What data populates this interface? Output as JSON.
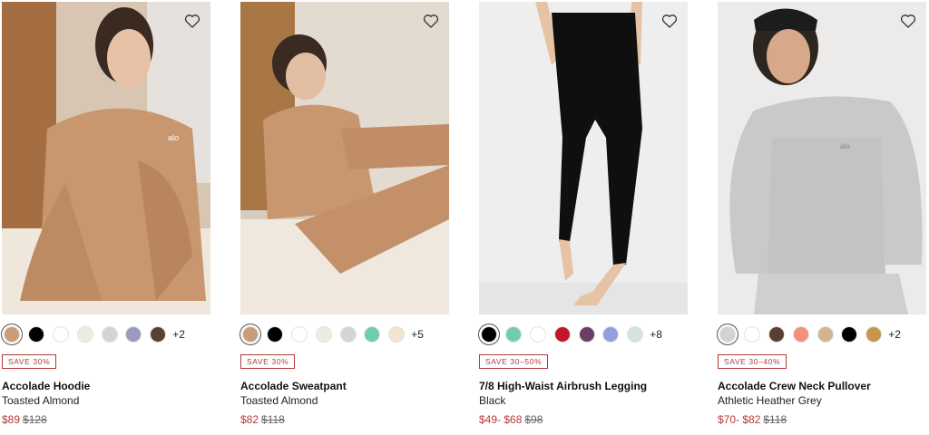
{
  "products": [
    {
      "name": "Accolade Hoodie",
      "color": "Toasted Almond",
      "badge": "SAVE 30%",
      "price": "$89",
      "original_price": "$128",
      "more_colors": "+2",
      "swatches": [
        "#c89d78",
        "#000000",
        "#ffffff",
        "#eeebe3",
        "#d4d4d6",
        "#9a9bbd",
        "#5a4030"
      ],
      "selected_swatch": 0
    },
    {
      "name": "Accolade Sweatpant",
      "color": "Toasted Almond",
      "badge": "SAVE 30%",
      "price": "$82",
      "original_price": "$118",
      "more_colors": "+5",
      "swatches": [
        "#c89d78",
        "#000000",
        "#ffffff",
        "#eeebe3",
        "#d4d4d6",
        "#6fcdae",
        "#f4e4d0"
      ],
      "selected_swatch": 0
    },
    {
      "name": "7/8 High-Waist Airbrush Legging",
      "color": "Black",
      "badge": "SAVE 30–50%",
      "price": "$49- $68",
      "original_price": "$98",
      "more_colors": "+8",
      "swatches": [
        "#000000",
        "#6fcdae",
        "#ffffff",
        "#c0182a",
        "#6a3e62",
        "#929fe0",
        "#d6e2dc"
      ],
      "selected_swatch": 0
    },
    {
      "name": "Accolade Crew Neck Pullover",
      "color": "Athletic Heather Grey",
      "badge": "SAVE 30–40%",
      "price": "$70- $82",
      "original_price": "$118",
      "more_colors": "+2",
      "swatches": [
        "#d3d3d3",
        "#ffffff",
        "#5a4030",
        "#f5907a",
        "#d4b48e",
        "#000000",
        "#c9954b"
      ],
      "selected_swatch": 0
    }
  ]
}
